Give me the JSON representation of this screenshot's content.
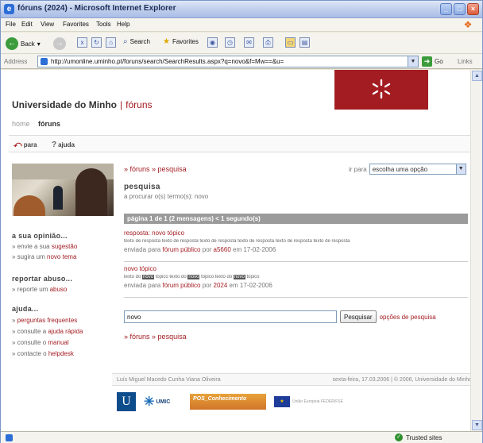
{
  "browser": {
    "title": "fóruns (2024) - Microsoft Internet Explorer",
    "menu": [
      "File",
      "Edit",
      "View",
      "Favorites",
      "Tools",
      "Help"
    ],
    "toolbar": {
      "back": "Back",
      "search": "Search",
      "favorites": "Favorites"
    },
    "address_label": "Address",
    "url": "http://umonline.uminho.pt/foruns/search/SearchResults.aspx?q=novo&f=Mw==&u=",
    "go": "Go",
    "links": "Links",
    "status_zone": "Trusted sites"
  },
  "site": {
    "university": "Universidade do Minho",
    "separator": "|",
    "section": "fóruns",
    "breadcrumb": {
      "home": "home",
      "current": "fóruns"
    },
    "subnav": {
      "exit": "para",
      "help": "ajuda"
    }
  },
  "sidebar": {
    "opinion": {
      "heading": "a sua opinião...",
      "items": [
        {
          "prefix": "» envie a sua ",
          "link": "sugestão"
        },
        {
          "prefix": "» sugira um ",
          "link": "novo tema"
        }
      ]
    },
    "report": {
      "heading": "reportar abuso...",
      "items": [
        {
          "prefix": "» reporte um ",
          "link": "abuso"
        }
      ]
    },
    "help": {
      "heading": "ajuda...",
      "items": [
        {
          "prefix": "» ",
          "link": "perguntas frequentes"
        },
        {
          "prefix": "» consulte a ",
          "link": "ajuda rápida"
        },
        {
          "prefix": "» consulte o ",
          "link": "manual"
        },
        {
          "prefix": "» contacte o ",
          "link": "helpdesk"
        }
      ]
    }
  },
  "main": {
    "crumb": {
      "a": "» fóruns",
      "b": "» pesquisa"
    },
    "goto_label": "ir para",
    "goto_value": "escolha uma opção",
    "heading": "pesquisa",
    "subheading": "a procurar o(s) termo(s): novo",
    "results_bar": "página 1 de 1 (2 mensagens) < 1 segundo(s)",
    "posts": [
      {
        "title": "resposta: novo tópico",
        "body": "texto de resposta texto de resposta  texto de resposta texto de resposta  texto de resposta texto de resposta",
        "meta_prefix": "enviada para ",
        "forum": "fórum público",
        "by": " por ",
        "author": "a5660",
        "date": " em 17-02-2006"
      },
      {
        "title": "novo tópico",
        "body_parts": [
          "texto do ",
          "novo",
          " tópico texto do ",
          "novo",
          " tópico texto do ",
          "novo",
          " tópico"
        ],
        "meta_prefix": "enviada para ",
        "forum": "fórum público",
        "by": " por ",
        "author": "2024",
        "date": " em 17-02-2006"
      }
    ],
    "search_value": "novo",
    "search_button": "Pesquisar",
    "search_options": "opções de pesquisa",
    "bottom_crumb": {
      "a": "» fóruns",
      "b": "» pesquisa"
    }
  },
  "footer": {
    "author": "Luís Miguel Macedo Cunha Viana Oliveira",
    "right": "sexta-feira, 17.03.2006 | © 2006, Universidade do Minho"
  },
  "logos": {
    "umic": "UMIC",
    "pos": "POS_Conhecimento",
    "eu": "União Europeia FEDER/FSE"
  },
  "colors": {
    "brand": "#a31c22",
    "results_bar": "#9b9b9b"
  }
}
